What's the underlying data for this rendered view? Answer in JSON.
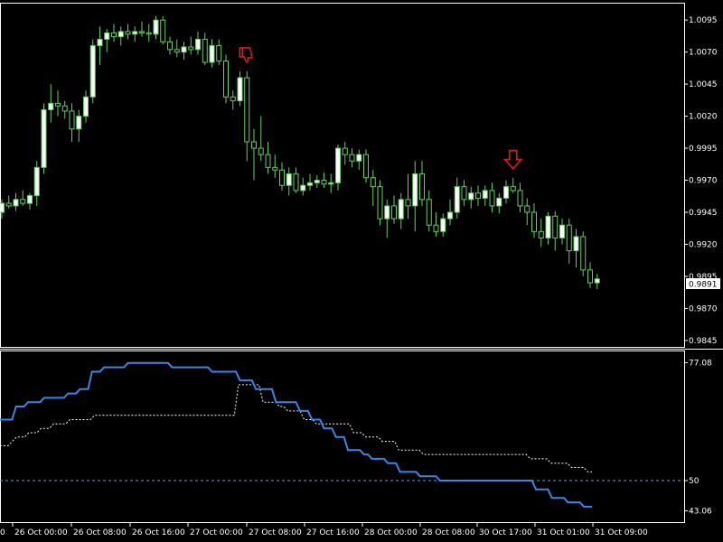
{
  "colors": {
    "background": "#000000",
    "grid_border": "#ffffff",
    "bull_candle": "#ffffff",
    "bear_candle": "#000000",
    "wick": "#5fd35f",
    "indicator_main": "#3a86e8",
    "indicator_signal": "#ffffff",
    "level_line": "#5fa8c8",
    "signal_marker": "#cc1f1f",
    "price_label_bg": "#ffffff"
  },
  "icons": {
    "thumbs_down": "thumbs-down-icon",
    "arrow_down": "arrow-down-icon"
  },
  "chart_data": [
    {
      "type": "candlestick",
      "price_axis_ticks": [
        "1.0095",
        "1.0070",
        "1.0045",
        "1.0020",
        "0.9995",
        "0.9970",
        "0.9945",
        "0.9920",
        "0.9895",
        "0.9870",
        "0.9845"
      ],
      "current_price_label": "0.9891",
      "ylim": [
        0.984,
        1.0105
      ],
      "time_labels": [
        "26 Oct 00:00",
        "26 Oct 08:00",
        "26 Oct 16:00",
        "27 Oct 00:00",
        "27 Oct 08:00",
        "27 Oct 16:00",
        "28 Oct 00:00",
        "28 Oct 08:00",
        "30 Oct 17:00",
        "31 Oct 01:00",
        "31 Oct 09:00"
      ],
      "left_edge_label": "0",
      "series": [
        {
          "values": [
            [
              0.9945,
              0.9955,
              0.994,
              0.9952
            ],
            [
              0.9952,
              0.9958,
              0.9948,
              0.995
            ],
            [
              0.995,
              0.996,
              0.9946,
              0.9955
            ],
            [
              0.9955,
              0.9962,
              0.995,
              0.9952
            ],
            [
              0.9952,
              0.996,
              0.9947,
              0.9958
            ],
            [
              0.9958,
              0.9985,
              0.995,
              0.998
            ],
            [
              0.998,
              1.003,
              0.9975,
              1.0025
            ],
            [
              1.0025,
              1.0045,
              1.0015,
              1.003
            ],
            [
              1.003,
              1.004,
              1.002,
              1.0028
            ],
            [
              1.0028,
              1.0032,
              1.0018,
              1.0024
            ],
            [
              1.0024,
              1.003,
              1.0,
              1.001
            ],
            [
              1.001,
              1.0025,
              1.0,
              1.002
            ],
            [
              1.002,
              1.004,
              1.0015,
              1.0035
            ],
            [
              1.0035,
              1.008,
              1.003,
              1.0075
            ],
            [
              1.0075,
              1.009,
              1.006,
              1.008
            ],
            [
              1.008,
              1.0088,
              1.007,
              1.0085
            ],
            [
              1.0085,
              1.0092,
              1.0078,
              1.0082
            ],
            [
              1.0082,
              1.009,
              1.0075,
              1.0086
            ],
            [
              1.0086,
              1.0092,
              1.008,
              1.0084
            ],
            [
              1.0084,
              1.009,
              1.0078,
              1.0086
            ],
            [
              1.0086,
              1.0094,
              1.0082,
              1.0085
            ],
            [
              1.0085,
              1.0092,
              1.0078,
              1.0084
            ],
            [
              1.0084,
              1.0098,
              1.008,
              1.0095
            ],
            [
              1.0095,
              1.0098,
              1.0076,
              1.0078
            ],
            [
              1.0078,
              1.0082,
              1.0068,
              1.0072
            ],
            [
              1.0072,
              1.008,
              1.0066,
              1.007
            ],
            [
              1.007,
              1.0078,
              1.0064,
              1.0074
            ],
            [
              1.0074,
              1.0082,
              1.0068,
              1.0072
            ],
            [
              1.0072,
              1.0086,
              1.0068,
              1.008
            ],
            [
              1.008,
              1.0085,
              1.006,
              1.0062
            ],
            [
              1.0062,
              1.008,
              1.0058,
              1.0075
            ],
            [
              1.0075,
              1.008,
              1.006,
              1.0063
            ],
            [
              1.0063,
              1.0068,
              1.003,
              1.0035
            ],
            [
              1.0035,
              1.004,
              1.0025,
              1.0032
            ],
            [
              1.0032,
              1.0055,
              1.0028,
              1.005
            ],
            [
              1.005,
              1.0055,
              0.9985,
              1.0
            ],
            [
              1.0,
              1.001,
              0.997,
              0.9995
            ],
            [
              0.9995,
              1.002,
              0.9985,
              0.999
            ],
            [
              0.999,
              1.0,
              0.9975,
              0.998
            ],
            [
              0.998,
              0.999,
              0.9972,
              0.9978
            ],
            [
              0.9978,
              0.9984,
              0.9962,
              0.9966
            ],
            [
              0.9966,
              0.998,
              0.9958,
              0.9975
            ],
            [
              0.9975,
              0.998,
              0.996,
              0.9962
            ],
            [
              0.9962,
              0.9972,
              0.9958,
              0.9966
            ],
            [
              0.9966,
              0.9975,
              0.9962,
              0.9968
            ],
            [
              0.9968,
              0.9974,
              0.9964,
              0.997
            ],
            [
              0.997,
              0.9976,
              0.9964,
              0.9967
            ],
            [
              0.9967,
              0.9975,
              0.996,
              0.9968
            ],
            [
              0.9968,
              0.9998,
              0.9962,
              0.9995
            ],
            [
              0.9995,
              1.0,
              0.9982,
              0.999
            ],
            [
              0.999,
              0.9995,
              0.998,
              0.9985
            ],
            [
              0.9985,
              0.9994,
              0.9978,
              0.999
            ],
            [
              0.999,
              0.9994,
              0.9968,
              0.9972
            ],
            [
              0.9972,
              0.9978,
              0.995,
              0.9965
            ],
            [
              0.9965,
              0.997,
              0.9935,
              0.994
            ],
            [
              0.994,
              0.9955,
              0.9925,
              0.995
            ],
            [
              0.995,
              0.9958,
              0.9936,
              0.994
            ],
            [
              0.994,
              0.996,
              0.9932,
              0.9955
            ],
            [
              0.9955,
              0.9975,
              0.994,
              0.995
            ],
            [
              0.995,
              0.9985,
              0.993,
              0.9975
            ],
            [
              0.9975,
              0.9985,
              0.995,
              0.9955
            ],
            [
              0.9955,
              0.9962,
              0.993,
              0.9935
            ],
            [
              0.9935,
              0.9945,
              0.9926,
              0.993
            ],
            [
              0.993,
              0.9944,
              0.9926,
              0.994
            ],
            [
              0.994,
              0.9955,
              0.9935,
              0.9945
            ],
            [
              0.9945,
              0.9972,
              0.994,
              0.9965
            ],
            [
              0.9965,
              0.997,
              0.995,
              0.9955
            ],
            [
              0.9955,
              0.9965,
              0.9948,
              0.996
            ],
            [
              0.996,
              0.9966,
              0.995,
              0.9956
            ],
            [
              0.9956,
              0.9966,
              0.995,
              0.9962
            ],
            [
              0.9962,
              0.9968,
              0.9945,
              0.995
            ],
            [
              0.995,
              0.996,
              0.9944,
              0.9956
            ],
            [
              0.9956,
              0.997,
              0.9952,
              0.9965
            ],
            [
              0.9965,
              0.9972,
              0.996,
              0.9962
            ],
            [
              0.9962,
              0.9968,
              0.9945,
              0.995
            ],
            [
              0.995,
              0.9956,
              0.9935,
              0.9945
            ],
            [
              0.9945,
              0.9952,
              0.9925,
              0.993
            ],
            [
              0.993,
              0.994,
              0.9918,
              0.9925
            ],
            [
              0.9925,
              0.9945,
              0.992,
              0.9942
            ],
            [
              0.9942,
              0.9946,
              0.9915,
              0.9925
            ],
            [
              0.9925,
              0.994,
              0.992,
              0.9935
            ],
            [
              0.9935,
              0.994,
              0.9905,
              0.9915
            ],
            [
              0.9915,
              0.9932,
              0.9902,
              0.9926
            ],
            [
              0.9926,
              0.993,
              0.9895,
              0.99
            ],
            [
              0.99,
              0.9906,
              0.9886,
              0.989
            ],
            [
              0.989,
              0.9897,
              0.9885,
              0.9893
            ]
          ]
        }
      ],
      "annotations": [
        {
          "type": "thumbs-down",
          "bar_index": 35
        },
        {
          "type": "arrow-down",
          "bar_index": 73
        }
      ]
    },
    {
      "type": "line",
      "yaxis_labels": [
        "77.08",
        "50",
        "43.06"
      ],
      "ylim": [
        41.5,
        78.0
      ],
      "level": 50,
      "series": [
        {
          "values": [
            64,
            64,
            64,
            64,
            67,
            67,
            67,
            68,
            68,
            68,
            68,
            69,
            69,
            69,
            69,
            69,
            69,
            70,
            70,
            70,
            71,
            71,
            71,
            75,
            75,
            75,
            76,
            76,
            76,
            76,
            76,
            76,
            77,
            77,
            77,
            77,
            77,
            77,
            77,
            77,
            77,
            77,
            77,
            76,
            76,
            76,
            76,
            76,
            76,
            76,
            76,
            76,
            76,
            75,
            75,
            75,
            75,
            75,
            75,
            75,
            73,
            73,
            73,
            73,
            71,
            71,
            71,
            71,
            71,
            68,
            68,
            68,
            68,
            68,
            68,
            66,
            66,
            66,
            64,
            64,
            64,
            62,
            62,
            62,
            60,
            60,
            60,
            57,
            57,
            57,
            57,
            56,
            56,
            55,
            55,
            55,
            55,
            54,
            54,
            54,
            52,
            52,
            52,
            52,
            52,
            51,
            51,
            51,
            51,
            51,
            50,
            50,
            50,
            50,
            50,
            50,
            50,
            50,
            50,
            50,
            50,
            50,
            50,
            50,
            50,
            50,
            50,
            50,
            50,
            50,
            50,
            50,
            50,
            50,
            48,
            48,
            48,
            48,
            46,
            46,
            46,
            46,
            45,
            45,
            45,
            45,
            44,
            44,
            44
          ]
        },
        {
          "values": [
            58,
            58,
            58,
            59,
            60,
            60,
            60,
            61,
            61,
            61,
            62,
            62,
            62,
            63,
            63,
            63,
            63,
            64,
            64,
            64,
            64,
            64,
            64,
            65,
            65,
            65,
            65,
            65,
            65,
            65,
            65,
            65,
            65,
            65,
            65,
            65,
            65,
            65,
            65,
            65,
            65,
            65,
            65,
            65,
            65,
            65,
            65,
            65,
            65,
            65,
            65,
            65,
            65,
            65,
            65,
            65,
            65,
            65,
            72,
            72,
            72,
            72,
            72,
            72,
            68,
            68,
            68,
            68,
            67,
            67,
            66,
            66,
            66,
            66,
            64,
            64,
            64,
            63,
            63,
            63,
            63,
            63,
            63,
            63,
            63,
            63,
            61,
            61,
            61,
            60,
            60,
            60,
            60,
            59,
            59,
            59,
            59,
            57,
            57,
            57,
            57,
            57,
            57,
            56,
            56,
            56,
            56,
            56,
            56,
            56,
            56,
            56,
            56,
            56,
            56,
            56,
            56,
            56,
            56,
            56,
            56,
            56,
            56,
            56,
            56,
            56,
            56,
            56,
            56,
            55,
            55,
            55,
            55,
            55,
            54,
            54,
            54,
            54,
            54,
            53,
            53,
            53,
            53,
            52,
            52
          ]
        }
      ]
    }
  ]
}
